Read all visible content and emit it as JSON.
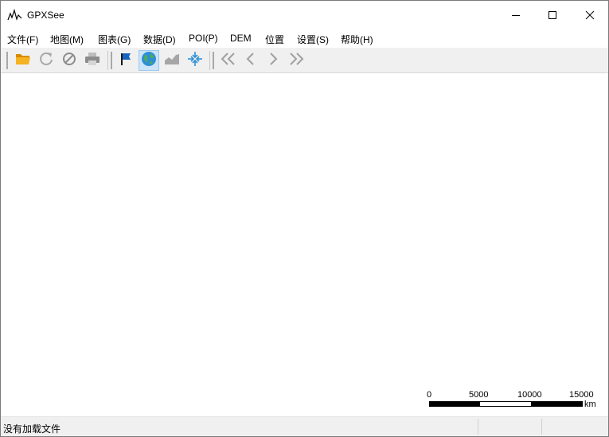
{
  "window": {
    "title": "GPXSee",
    "icon": "gpxsee-logo-icon",
    "controls": [
      "minimize-icon",
      "maximize-icon",
      "close-icon"
    ]
  },
  "menu": [
    {
      "label": "文件(F)"
    },
    {
      "label": "地图(M)"
    },
    {
      "label": "图表(G)"
    },
    {
      "label": "数据(D)"
    },
    {
      "label": "POI(P)"
    },
    {
      "label": "DEM"
    },
    {
      "label": "位置"
    },
    {
      "label": "设置(S)"
    },
    {
      "label": "帮助(H)"
    }
  ],
  "toolbar": {
    "buttons": [
      {
        "icon": "open-folder-icon",
        "color": "#f0a30a"
      },
      {
        "icon": "reload-icon",
        "color": "#a0a0a0"
      },
      {
        "icon": "close-file-icon",
        "color": "#8a8a8a"
      },
      {
        "icon": "print-icon",
        "color": "#8a8a8a"
      },
      {
        "icon": "flag-icon",
        "color": "#1565c0"
      },
      {
        "icon": "globe-icon",
        "color": "#2e8fd6",
        "active": true
      },
      {
        "icon": "graph-icon",
        "color": "#9a9a9a"
      },
      {
        "icon": "zoom-fit-icon",
        "color": "#2e8fd6"
      },
      {
        "icon": "first-icon",
        "color": "#9a9a9a"
      },
      {
        "icon": "previous-icon",
        "color": "#9a9a9a"
      },
      {
        "icon": "next-icon",
        "color": "#9a9a9a"
      },
      {
        "icon": "last-icon",
        "color": "#9a9a9a"
      }
    ]
  },
  "map": {
    "scale": {
      "labels": [
        "0",
        "5000",
        "10000",
        "15000"
      ],
      "unit": "km"
    }
  },
  "status": {
    "text": "没有加载文件"
  }
}
